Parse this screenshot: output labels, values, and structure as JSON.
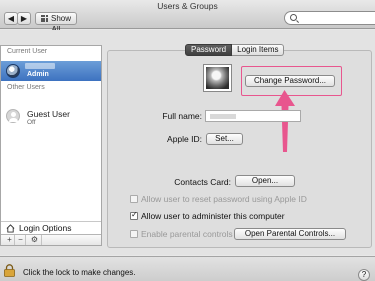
{
  "window": {
    "title": "Users & Groups",
    "show_all_label": "Show All",
    "search_placeholder": ""
  },
  "sidebar": {
    "current_user_header": "Current User",
    "current_user": {
      "role": "Admin",
      "selected": true
    },
    "other_users_header": "Other Users",
    "guest": {
      "name": "Guest User",
      "status": "Off"
    },
    "login_options_label": "Login Options",
    "toolbar": {
      "add": "+",
      "remove": "−",
      "action": "⚙"
    }
  },
  "tabs": [
    {
      "label": "Password",
      "active": true
    },
    {
      "label": "Login Items",
      "active": false
    }
  ],
  "password_tab": {
    "change_password_label": "Change Password...",
    "full_name_label": "Full name:",
    "full_name_value": "",
    "apple_id_label": "Apple ID:",
    "apple_id_button": "Set...",
    "contacts_card_label": "Contacts Card:",
    "contacts_card_button": "Open...",
    "checkboxes": [
      {
        "label": "Allow user to reset password using Apple ID",
        "checked": false,
        "enabled": false
      },
      {
        "label": "Allow user to administer this computer",
        "checked": true,
        "enabled": true
      },
      {
        "label": "Enable parental controls",
        "checked": false,
        "enabled": false
      }
    ],
    "parental_controls_button": "Open Parental Controls..."
  },
  "footer": {
    "lock_label": "Click the lock to make changes.",
    "help_label": "?"
  },
  "colors": {
    "highlight": "#e8568e",
    "selection": "#3d72c0",
    "active_tab": "#4a4a4a"
  },
  "icons": {
    "nav_back": "chevron-left-icon",
    "nav_forward": "chevron-right-icon",
    "show_all": "grid-icon",
    "search": "search-icon",
    "login_options": "house-icon",
    "action": "gear-icon",
    "lock": "lock-icon",
    "annotation": "arrow-up-icon"
  }
}
